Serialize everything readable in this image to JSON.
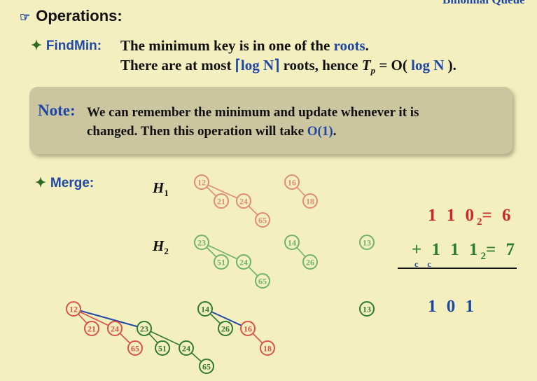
{
  "corner_title": "Binomial Queue",
  "heading": {
    "bullet": "☞",
    "text": "Operations:"
  },
  "findmin": {
    "diamond": "✦",
    "label": "FindMin:",
    "line1_text": "The minimum key is in one of the ",
    "line1_blue": "roots",
    "line1_end": ".",
    "line2_a": "There are at most ",
    "line2_blue": "⌈log N⌉",
    "line2_b": " roots, hence ",
    "line2_tp": "T",
    "line2_p": "p",
    "line2_c": " = O( ",
    "line2_blue2": "log N",
    "line2_d": " )."
  },
  "note": {
    "title": "Note:",
    "line1": "We can remember the minimum and update whenever it is",
    "line2_a": "changed.  Then this operation will take ",
    "line2_blue": "O(1)",
    "line2_end": "."
  },
  "merge": {
    "diamond": "✦",
    "label": "Merge:",
    "h1_letter": "H",
    "h1_sub": "1",
    "h2_letter": "H",
    "h2_sub": "2"
  },
  "arithmetic": {
    "row1": "1 1 0",
    "row1_sub": "2",
    "row1_eq": "= 6",
    "row2": "+ 1 1 1",
    "row2_sub": "2",
    "row2_eq": "= 7",
    "carry": "c c",
    "result": "1 0 1"
  },
  "colors": {
    "red": "#d9534a",
    "green": "#2f8a2f",
    "blue": "#1f47a6"
  },
  "trees": {
    "h1": {
      "color": "#d9534a",
      "nodes": [
        "12",
        "21",
        "24",
        "65",
        "16",
        "18"
      ]
    },
    "h2": {
      "color": "#3a9a3a",
      "nodes": [
        "23",
        "51",
        "24",
        "65",
        "14",
        "26",
        "13"
      ]
    },
    "result_nodes": [
      "12",
      "21",
      "24",
      "23",
      "65",
      "51",
      "24",
      "65",
      "14",
      "26",
      "16",
      "18",
      "13"
    ]
  }
}
